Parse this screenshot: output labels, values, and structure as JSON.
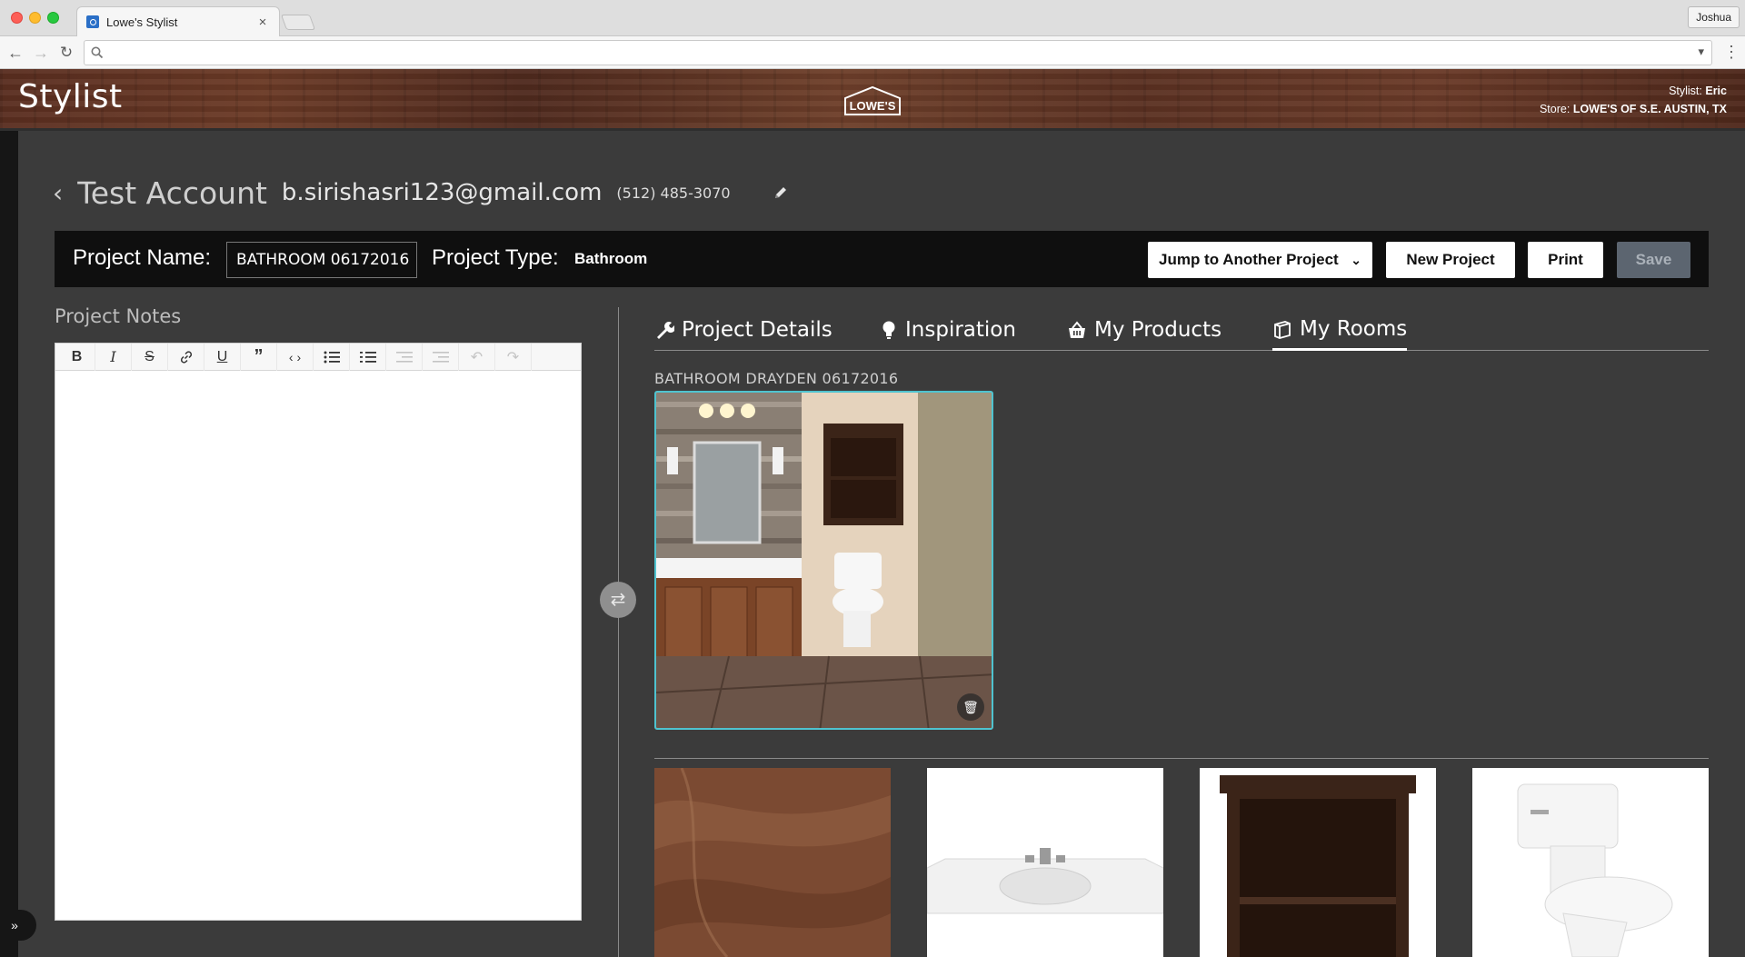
{
  "browser": {
    "tab_title": "Lowe's Stylist",
    "tab_close": "×",
    "profile_name": "Joshua",
    "address_value": ""
  },
  "header": {
    "app_title": "Stylist",
    "logo_text": "LOWE'S",
    "stylist_label": "Stylist:",
    "stylist_name": "Eric",
    "store_label": "Store:",
    "store_name": "LOWE'S OF S.E. AUSTIN, TX"
  },
  "account": {
    "name": "Test Account",
    "email": "b.sirishasri123@gmail.com",
    "phone": "(512) 485-3070"
  },
  "project_bar": {
    "name_label": "Project Name:",
    "name_value": "BATHROOM 06172016",
    "type_label": "Project Type:",
    "type_value": "Bathroom",
    "jump_label": "Jump to Another Project",
    "new_label": "New Project",
    "print_label": "Print",
    "save_label": "Save"
  },
  "notes": {
    "label": "Project Notes",
    "toolbar": [
      "bold",
      "italic",
      "strikethrough",
      "link",
      "underline",
      "quote",
      "code",
      "bullet-list",
      "numbered-list",
      "outdent",
      "indent",
      "undo",
      "redo"
    ]
  },
  "tabs": [
    {
      "label": "Project Details",
      "icon": "wrench-icon"
    },
    {
      "label": "Inspiration",
      "icon": "lightbulb-icon"
    },
    {
      "label": "My Products",
      "icon": "basket-icon"
    },
    {
      "label": "My Rooms",
      "icon": "rooms-icon",
      "active": true
    }
  ],
  "rooms": {
    "title": "BATHROOM DRAYDEN 06172016"
  },
  "products": [
    {
      "name": "tile-swatch"
    },
    {
      "name": "vanity-top"
    },
    {
      "name": "wall-cabinet"
    },
    {
      "name": "toilet"
    }
  ],
  "colors": {
    "background": "#3b3b3b",
    "project_bar": "#0f0f0f",
    "room_border": "#4fc3cf",
    "save_disabled": "#5c6570"
  }
}
